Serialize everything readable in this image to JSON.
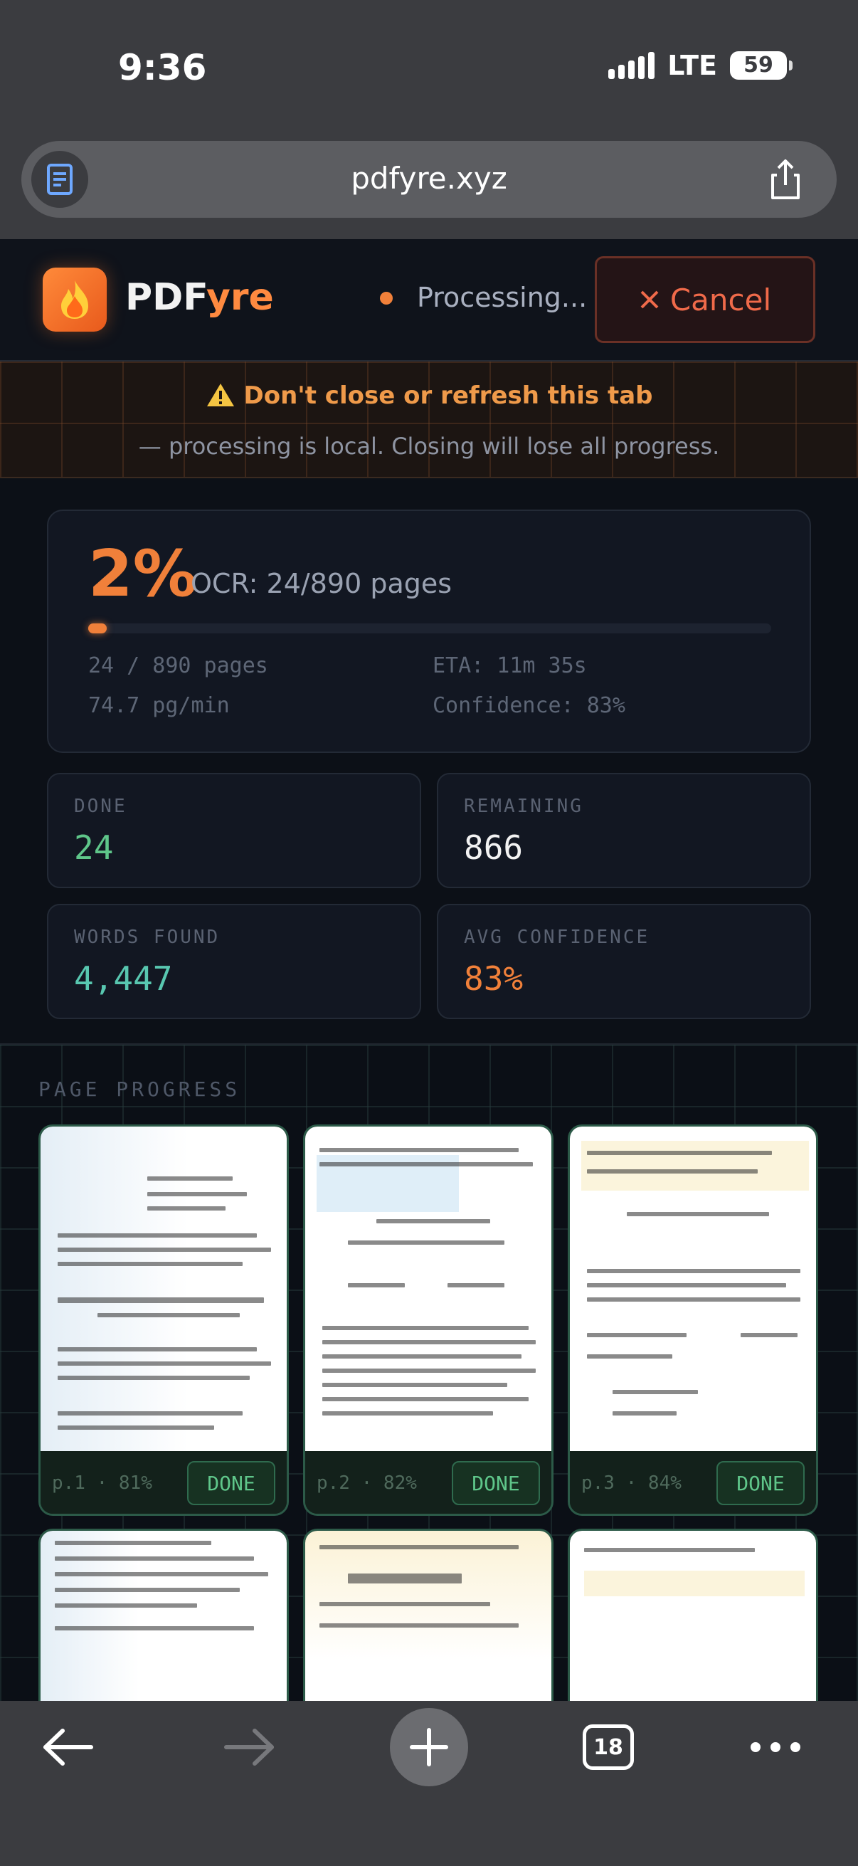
{
  "status_bar": {
    "time": "9:36",
    "network": "LTE",
    "battery": "59"
  },
  "browser": {
    "url": "pdfyre.xyz",
    "tab_count": "18"
  },
  "header": {
    "brand_part1": "PDF",
    "brand_part2": "yre",
    "status_text": "Processing...",
    "cancel_label": "Cancel",
    "accent_color": "#f0803a"
  },
  "warning": {
    "title": "Don't close or refresh this tab",
    "subtitle": "— processing is local. Closing will lose all progress."
  },
  "progress": {
    "percent_label": "2%",
    "percent_value": 0.027,
    "ocr_label": "OCR: 24/890 pages",
    "pages_line": "24 / 890 pages",
    "eta_line": "ETA: 11m 35s",
    "rate_line": "74.7 pg/min",
    "confidence_line": "Confidence: 83%"
  },
  "stats": {
    "done": {
      "label": "DONE",
      "value": "24",
      "color": "#5fc68a"
    },
    "remaining": {
      "label": "REMAINING",
      "value": "866",
      "color": "#f2f2f2"
    },
    "words": {
      "label": "WORDS FOUND",
      "value": "4,447",
      "color": "#58c7b0"
    },
    "avg_conf": {
      "label": "AVG CONFIDENCE",
      "value": "83%",
      "color": "#f0803a"
    }
  },
  "page_progress": {
    "label": "PAGE PROGRESS",
    "pages": [
      {
        "meta": "p.1 · 81%",
        "status": "DONE"
      },
      {
        "meta": "p.2 · 82%",
        "status": "DONE"
      },
      {
        "meta": "p.3 · 84%",
        "status": "DONE"
      }
    ]
  }
}
